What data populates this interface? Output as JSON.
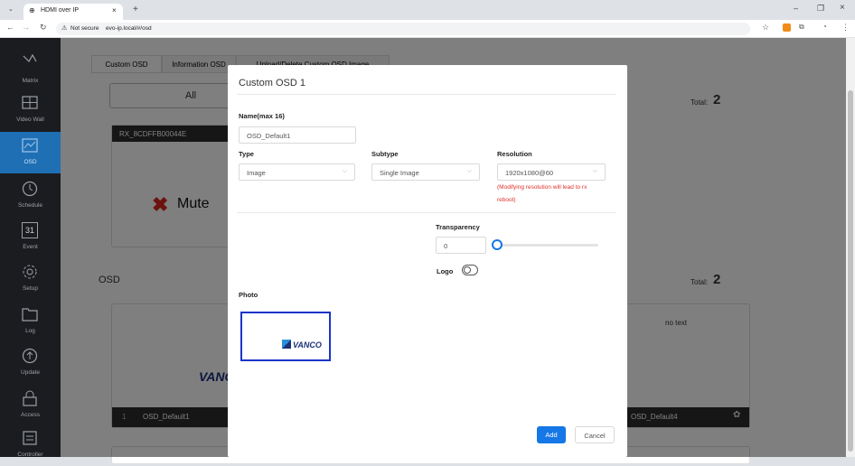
{
  "browser": {
    "tab_title": "HDMI over IP",
    "security_label": "Not secure",
    "url": "evo-ip.local/#/osd"
  },
  "sidebar": {
    "items": [
      {
        "label": "Matrix",
        "icon": "matrix-icon"
      },
      {
        "label": "Video Wall",
        "icon": "video-wall-icon"
      },
      {
        "label": "OSD",
        "icon": "osd-icon"
      },
      {
        "label": "Schedule",
        "icon": "schedule-icon"
      },
      {
        "label": "Event",
        "icon": "event-icon",
        "badge": "31"
      },
      {
        "label": "Setup",
        "icon": "setup-icon"
      },
      {
        "label": "Log",
        "icon": "log-icon"
      },
      {
        "label": "Update",
        "icon": "update-icon"
      },
      {
        "label": "Access",
        "icon": "access-icon"
      },
      {
        "label": "Controller",
        "icon": "controller-icon"
      }
    ]
  },
  "page": {
    "tabs": [
      "Custom OSD",
      "Information OSD",
      "Upload/Delete Custom OSD Image"
    ],
    "filter_all": "All",
    "total_label": "Total:",
    "total_value_1": "2",
    "total_value_2": "2",
    "rx_name": "RX_8CDFFB00044E",
    "mute_label": "Mute",
    "osd_section_title": "OSD",
    "card1_index": "1",
    "card1_name": "OSD_Default1",
    "card2_no_text": "no text",
    "card2_name": "OSD_Default4",
    "logo_partial": "VANC"
  },
  "modal": {
    "title": "Custom OSD 1",
    "name_label": "Name(max 16)",
    "name_value": "OSD_Default1",
    "type_label": "Type",
    "type_value": "Image",
    "subtype_label": "Subtype",
    "subtype_value": "Single Image",
    "resolution_label": "Resolution",
    "resolution_value": "1920x1080@60",
    "resolution_warning_1": "(Modifying resolution will lead to rx",
    "resolution_warning_2": "reboot)",
    "transparency_label": "Transparency",
    "transparency_value": "0",
    "logo_label": "Logo",
    "photo_label": "Photo",
    "photo_logo_text": "VANCO",
    "add_button": "Add",
    "cancel_button": "Cancel"
  },
  "colors": {
    "accent": "#1f6fb4",
    "sidebar_bg": "#1b1c20",
    "warning": "#e0312b",
    "add_button": "#1677e6",
    "photo_border": "#1a35c9"
  }
}
